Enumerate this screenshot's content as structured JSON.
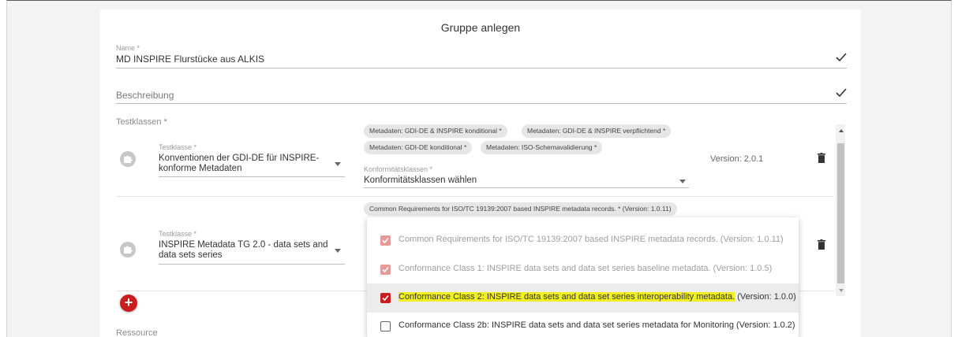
{
  "dialog": {
    "title": "Gruppe anlegen"
  },
  "name_field": {
    "label": "Name *",
    "value": "MD INSPIRE Flurstücke aus ALKIS"
  },
  "description_field": {
    "placeholder": "Beschreibung"
  },
  "testklassen": {
    "label": "Testklassen *",
    "rows": [
      {
        "testklasse_label": "Testklasse *",
        "testklasse_line1": "Konventionen der GDI-DE für INSPIRE-",
        "testklasse_line2": "konforme Metadaten",
        "chips": [
          "Metadaten: GDI-DE & INSPIRE konditional *",
          "Metadaten: GDI-DE & INSPIRE verpflichtend *",
          "Metadaten: GDI-DE konditional *",
          "Metadaten: ISO-Schemavalidierung *"
        ],
        "konformitaet_label": "Konformitätsklassen *",
        "konformitaet_value": "Konformitätsklassen wählen",
        "version": "Version: 2.0.1"
      },
      {
        "testklasse_label": "Testklasse *",
        "testklasse_line1": "INSPIRE Metadata TG 2.0 - data sets and",
        "testklasse_line2": "data sets series",
        "chips": [
          "Common Requirements for ISO/TC 19139:2007 based INSPIRE metadata records. * (Version: 1.0.11)"
        ]
      }
    ]
  },
  "ressource": {
    "label": "Ressource"
  },
  "dropdown": {
    "options": [
      {
        "text": "Common Requirements for ISO/TC 19139:2007 based INSPIRE metadata records. (Version: 1.0.11)",
        "state": "disabled-checked"
      },
      {
        "text": "Conformance Class 1: INSPIRE data sets and data set series baseline metadata. (Version: 1.0.5)",
        "state": "disabled-checked"
      },
      {
        "text_highlighted": "Conformance Class 2: INSPIRE data sets and data set series interoperability metadata.",
        "text_rest": " (Version: 1.0.0)",
        "state": "checked"
      },
      {
        "text": "Conformance Class 2b: INSPIRE data sets and data set series metadata for Monitoring (Version: 1.0.2)",
        "state": "unchecked"
      }
    ]
  },
  "colors": {
    "accent": "#c81e1e",
    "highlight": "#f2ef20",
    "chip_bg": "#e6e6e6"
  },
  "icons": {
    "confirm": "check-icon",
    "delete": "trash-icon",
    "add": "plus-icon",
    "testclass": "puzzle-icon"
  }
}
